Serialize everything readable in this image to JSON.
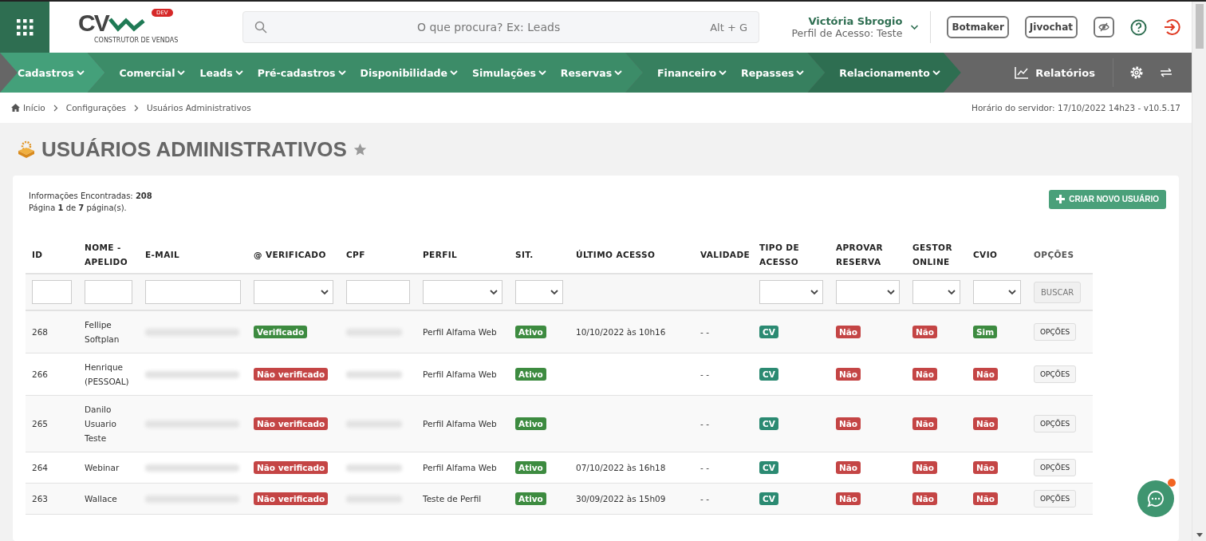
{
  "logo": {
    "mark": "CV",
    "badge": "DEV",
    "tagline": "CONSTRUTOR DE VENDAS"
  },
  "search": {
    "placeholder": "O que procura? Ex: Leads",
    "shortcut": "Alt + G"
  },
  "user": {
    "name": "Victória Sbrogio",
    "profile": "Perfil de Acesso: Teste"
  },
  "header_buttons": [
    "Botmaker",
    "Jivochat"
  ],
  "nav_groups": [
    {
      "color": "#44a07a",
      "items": [
        "Cadastros"
      ]
    },
    {
      "color": "#3c8c68",
      "items": [
        "Comercial",
        "Leads",
        "Pré-cadastros",
        "Disponibilidade",
        "Simulações",
        "Reservas"
      ]
    },
    {
      "color": "#37805f",
      "items": [
        "Financeiro",
        "Repasses"
      ]
    },
    {
      "color": "#2e6e51",
      "items": [
        "Relacionamento"
      ]
    }
  ],
  "reports": "Relatórios",
  "breadcrumb": [
    "Início",
    "Configurações",
    "Usuários Administrativos"
  ],
  "server_time": "Horário do servidor: 17/10/2022 14h23 - v10.5.17",
  "page_title": "USUÁRIOS ADMINISTRATIVOS",
  "summary": {
    "found": "Informações Encontradas: **208**",
    "page": "Página **1** de **7** página(s)."
  },
  "create_button": "CRIAR NOVO USUÁRIO",
  "table": {
    "columns": [
      "ID",
      "NOME - APELIDO",
      "E-MAIL",
      "@ VERIFICADO",
      "CPF",
      "PERFIL",
      "SIT.",
      "ÚLTIMO ACESSO",
      "VALIDADE",
      "TIPO DE ACESSO",
      "APROVAR RESERVA",
      "GESTOR ONLINE",
      "CVIO",
      "OPÇÕES"
    ],
    "filters": [
      {
        "kind": "text"
      },
      {
        "kind": "text"
      },
      {
        "kind": "text"
      },
      {
        "kind": "select"
      },
      {
        "kind": "text"
      },
      {
        "kind": "select"
      },
      {
        "kind": "select"
      },
      {
        "kind": "none"
      },
      {
        "kind": "none"
      },
      {
        "kind": "select"
      },
      {
        "kind": "select"
      },
      {
        "kind": "select"
      },
      {
        "kind": "select"
      },
      {
        "kind": "button",
        "label": "BUSCAR"
      }
    ],
    "rows": [
      {
        "id": "268",
        "name": "Fellipe Softplan",
        "verified": {
          "text": "Verificado",
          "on": true
        },
        "profile": "Perfil Alfama Web",
        "status": {
          "text": "Ativo",
          "on": true
        },
        "last_access": "10/10/2022 às 10h16",
        "validity": "- -",
        "access_type": "CV",
        "approve": {
          "text": "Não",
          "on": false
        },
        "manager": {
          "text": "Não",
          "on": false
        },
        "cvio": {
          "text": "Sim",
          "on": true
        },
        "options": "OPÇÕES"
      },
      {
        "id": "266",
        "name": "Henrique (PESSOAL)",
        "verified": {
          "text": "Não verificado",
          "on": false
        },
        "profile": "Perfil Alfama Web",
        "status": {
          "text": "Ativo",
          "on": true
        },
        "validity": "- -",
        "access_type": "CV",
        "approve": {
          "text": "Não",
          "on": false
        },
        "manager": {
          "text": "Não",
          "on": false
        },
        "cvio": {
          "text": "Não",
          "on": false
        },
        "options": "OPÇÕES"
      },
      {
        "id": "265",
        "name": "Danilo Usuario Teste",
        "verified": {
          "text": "Não verificado",
          "on": false
        },
        "profile": "Perfil Alfama Web",
        "status": {
          "text": "Ativo",
          "on": true
        },
        "validity": "- -",
        "access_type": "CV",
        "approve": {
          "text": "Não",
          "on": false
        },
        "manager": {
          "text": "Não",
          "on": false
        },
        "cvio": {
          "text": "Não",
          "on": false
        },
        "options": "OPÇÕES"
      },
      {
        "id": "264",
        "name": "Webinar",
        "verified": {
          "text": "Não verificado",
          "on": false
        },
        "profile": "Perfil Alfama Web",
        "status": {
          "text": "Ativo",
          "on": true
        },
        "last_access": "07/10/2022 às 16h18",
        "validity": "- -",
        "access_type": "CV",
        "approve": {
          "text": "Não",
          "on": false
        },
        "manager": {
          "text": "Não",
          "on": false
        },
        "cvio": {
          "text": "Não",
          "on": false
        },
        "options": "OPÇÕES"
      },
      {
        "id": "263",
        "name": "Wallace",
        "verified": {
          "text": "Não verificado",
          "on": false
        },
        "profile": "Teste de Perfil",
        "status": {
          "text": "Ativo",
          "on": true
        },
        "last_access": "30/09/2022 às 15h09",
        "validity": "- -",
        "access_type": "CV",
        "approve": {
          "text": "Não",
          "on": false
        },
        "manager": {
          "text": "Não",
          "on": false
        },
        "cvio": {
          "text": "Não",
          "on": false
        },
        "options": "OPÇÕES"
      }
    ]
  }
}
